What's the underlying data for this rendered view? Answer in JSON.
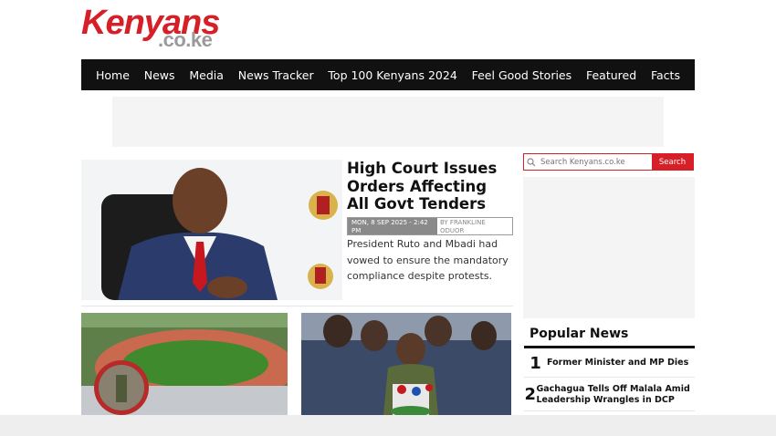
{
  "logo": {
    "brand": "Kenyans",
    "tld": ".co.ke"
  },
  "nav": {
    "items": [
      "Home",
      "News",
      "Media",
      "News Tracker",
      "Top 100 Kenyans 2024",
      "Feel Good Stories",
      "Featured",
      "Facts"
    ]
  },
  "lead": {
    "title": "High Court Issues Orders Affecting All Govt Tenders",
    "date": "MON, 8 SEP 2025 - 2:42 PM",
    "author": "BY FRANKLINE ODUOR",
    "summary": "President Ruto and Mbadi had vowed to ensure the mandatory compliance despite protests."
  },
  "search": {
    "placeholder": "Search Kenyans.co.ke",
    "button_label": "Search"
  },
  "popular": {
    "title": "Popular News",
    "items": [
      {
        "rank": "1",
        "headline": "Former Minister and MP Dies"
      },
      {
        "rank": "2",
        "headline": "Gachagua Tells Off Malala Amid Leadership Wrangles in DCP"
      }
    ]
  },
  "colors": {
    "brand_red": "#d61f26",
    "nav_bg": "#111111",
    "grey": "#9a9a9a"
  },
  "icons": {
    "search": "search-icon"
  }
}
